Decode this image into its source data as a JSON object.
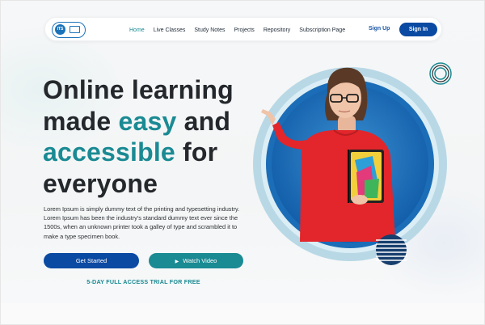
{
  "logo": {
    "badge_text": "ITS",
    "icon": "monitor-icon"
  },
  "nav": {
    "links": [
      {
        "label": "Home",
        "active": true
      },
      {
        "label": "Live Classes"
      },
      {
        "label": "Study Notes"
      },
      {
        "label": "Projects"
      },
      {
        "label": "Repository"
      },
      {
        "label": "Subscription Page"
      }
    ],
    "signup_label": "Sign Up",
    "signin_label": "Sign In"
  },
  "hero": {
    "headline": {
      "line1": "Online learning",
      "line2_a": "made ",
      "line2_accent": "easy",
      "line2_b": " and",
      "line3_accent": "accessible",
      "line3_b": " for",
      "line4": "everyone"
    },
    "description": "Lorem Ipsum is simply dummy text of the printing and typesetting industry. Lorem Ipsum has been the industry's standard dummy text ever since the 1500s, when an unknown printer took a galley of type and scrambled it to make a type specimen book.",
    "get_started_label": "Get Started",
    "watch_video_label": "Watch Video",
    "trial_text": "5-DAY FULL ACCESS TRIAL FOR FREE"
  },
  "colors": {
    "primary_blue": "#0b4aa2",
    "teal": "#1a8a93",
    "heading": "#24272b",
    "ring_outer": "#a8cfe0",
    "ring_inner": "#1f6fb8",
    "shirt_red": "#e2262b"
  }
}
